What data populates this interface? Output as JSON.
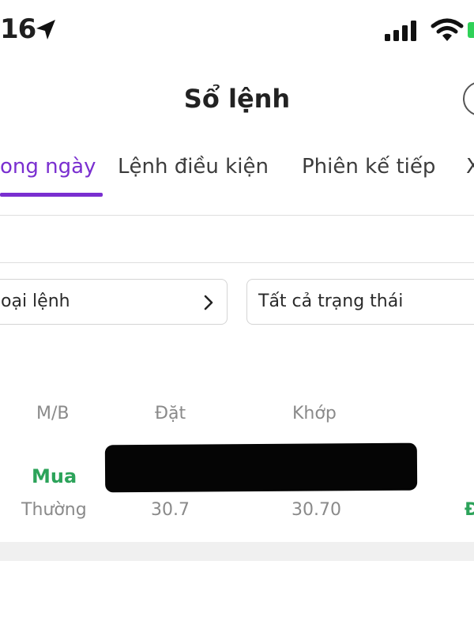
{
  "status_bar": {
    "time": "16",
    "icons": [
      "location-arrow-icon",
      "signal-bars-icon",
      "wifi-icon",
      "battery-icon"
    ]
  },
  "header": {
    "title": "Sổ lệnh",
    "right_icon": "circle-button-icon"
  },
  "tabs": [
    {
      "label": "ong ngày",
      "active": true
    },
    {
      "label": "Lệnh điều kiện",
      "active": false
    },
    {
      "label": "Phiên kế tiếp",
      "active": false
    },
    {
      "label": "X",
      "active": false
    }
  ],
  "filters": {
    "order_type": {
      "value": "oại lệnh",
      "icon": "chevron-right-icon"
    },
    "status": {
      "value": "Tất cả trạng thái"
    }
  },
  "table": {
    "headers": [
      "M/B",
      "Đặt",
      "Khớp"
    ],
    "rows": [
      {
        "side": "Mua",
        "order_type": "Thường",
        "placed_price": "30.7",
        "matched_price": "30.70",
        "status": "Đ"
      }
    ]
  },
  "colors": {
    "accent": "#7a2fd0",
    "buy": "#2ca35a",
    "muted_text": "#8a8a8a"
  }
}
